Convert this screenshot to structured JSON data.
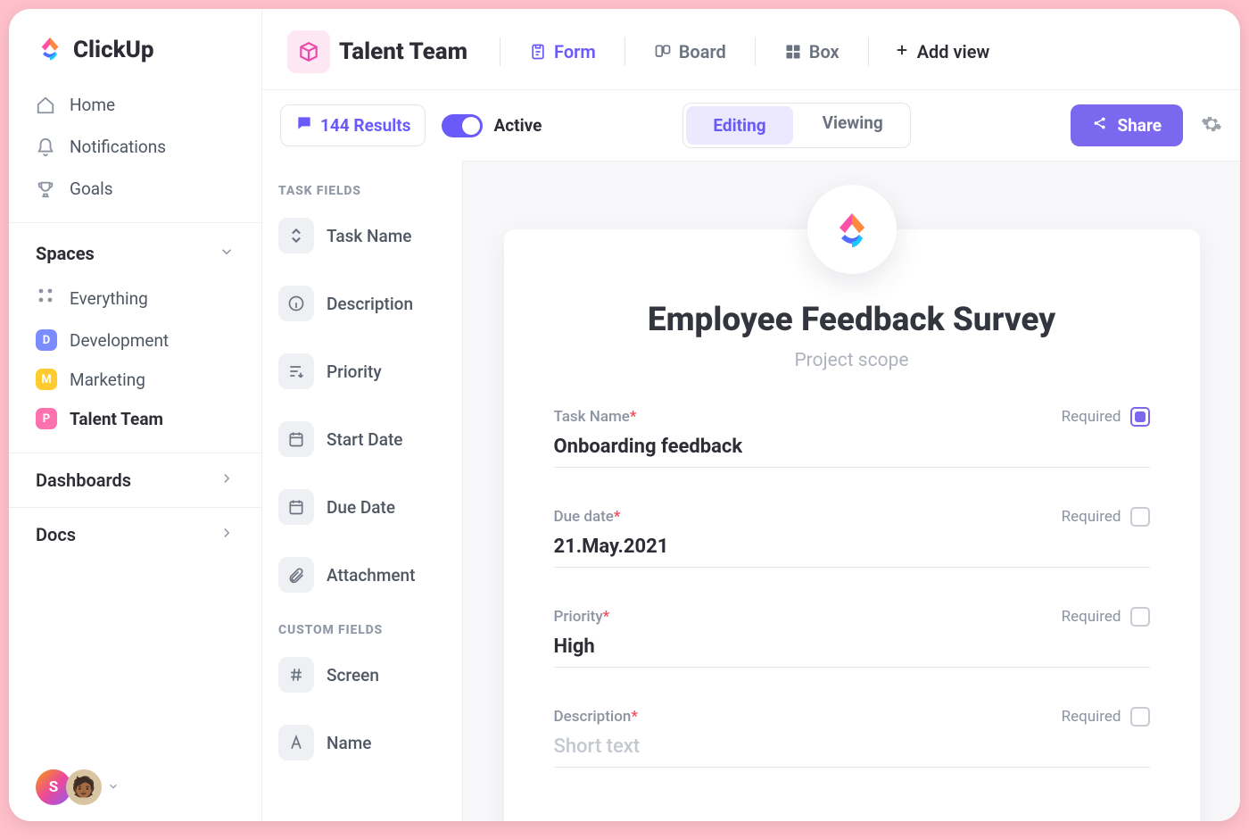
{
  "brand": "ClickUp",
  "nav": {
    "home": "Home",
    "notifications": "Notifications",
    "goals": "Goals"
  },
  "spaces_header": "Spaces",
  "everything": "Everything",
  "spaces": [
    {
      "letter": "D",
      "name": "Development",
      "color": "#7b8cff"
    },
    {
      "letter": "M",
      "name": "Marketing",
      "color": "#ffcb2f"
    },
    {
      "letter": "P",
      "name": "Talent Team",
      "color": "#fd71af",
      "active": true
    }
  ],
  "bottom": {
    "dashboards": "Dashboards",
    "docs": "Docs"
  },
  "avatar_letter": "S",
  "topbar": {
    "space": "Talent Team",
    "views": {
      "form": "Form",
      "board": "Board",
      "box": "Box",
      "add": "Add view"
    }
  },
  "controls": {
    "results": "144 Results",
    "active": "Active",
    "editing": "Editing",
    "viewing": "Viewing",
    "share": "Share"
  },
  "fields": {
    "task_header": "TASK FIELDS",
    "task": [
      "Task Name",
      "Description",
      "Priority",
      "Start Date",
      "Due Date",
      "Attachment"
    ],
    "custom_header": "CUSTOM FIELDS",
    "custom": [
      "Screen",
      "Name"
    ]
  },
  "form": {
    "title": "Employee Feedback Survey",
    "subtitle": "Project scope",
    "required_label": "Required",
    "rows": [
      {
        "label": "Task Name",
        "value": "Onboarding feedback",
        "required_on": true
      },
      {
        "label": "Due date",
        "value": "21.May.2021",
        "required_on": false
      },
      {
        "label": "Priority",
        "value": "High",
        "required_on": false
      },
      {
        "label": "Description",
        "value": "Short text",
        "required_on": false,
        "placeholder": true
      }
    ]
  }
}
